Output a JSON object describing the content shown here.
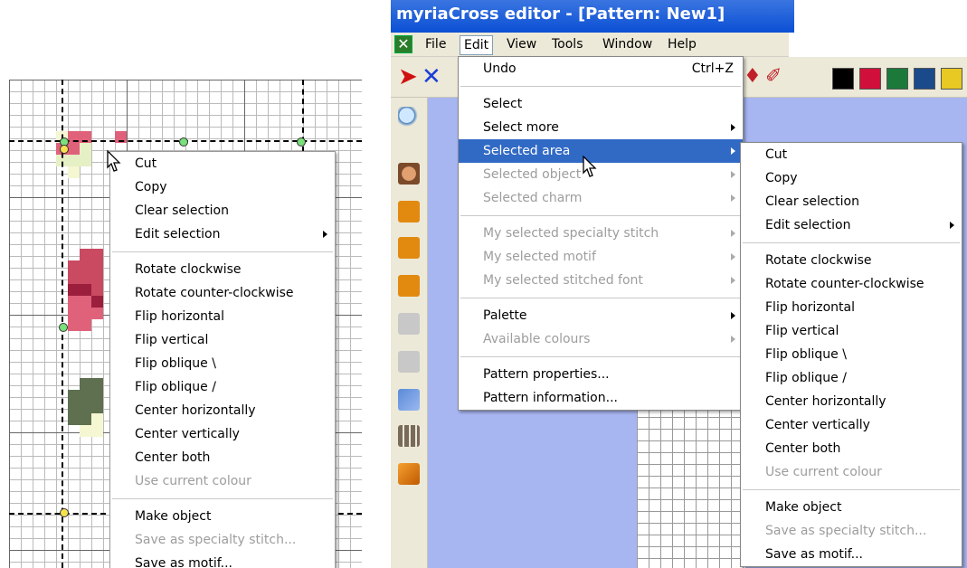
{
  "left_panel": {
    "context_menu": {
      "items": [
        {
          "label": "Cut",
          "enabled": true
        },
        {
          "label": "Copy",
          "enabled": true
        },
        {
          "label": "Clear selection",
          "enabled": true
        },
        {
          "label": "Edit selection",
          "enabled": true,
          "submenu": true
        },
        {
          "separator": true
        },
        {
          "label": "Rotate clockwise",
          "enabled": true
        },
        {
          "label": "Rotate counter-clockwise",
          "enabled": true
        },
        {
          "label": "Flip horizontal",
          "enabled": true
        },
        {
          "label": "Flip vertical",
          "enabled": true
        },
        {
          "label": "Flip oblique \\",
          "enabled": true
        },
        {
          "label": "Flip oblique /",
          "enabled": true
        },
        {
          "label": "Center horizontally",
          "enabled": true
        },
        {
          "label": "Center vertically",
          "enabled": true
        },
        {
          "label": "Center both",
          "enabled": true
        },
        {
          "label": "Use current colour",
          "enabled": false
        },
        {
          "separator": true
        },
        {
          "label": "Make object",
          "enabled": true
        },
        {
          "label": "Save as specialty stitch...",
          "enabled": false
        },
        {
          "label": "Save as motif...",
          "enabled": true
        }
      ]
    },
    "colors": {
      "pink": "#e0627a",
      "darkpink": "#c94a61",
      "maroon": "#9b1f3c",
      "green": "#5e7050",
      "lightgreen": "#e5f0c5",
      "paleyellow": "#f5f7d2"
    }
  },
  "right_panel": {
    "window_title": "myriaCross editor - [Pattern: New1]",
    "menubar": {
      "items": [
        "File",
        "Edit",
        "View",
        "Tools",
        "Window",
        "Help"
      ],
      "active": "Edit"
    },
    "toolbar_colors": [
      "#000000",
      "#d0103a",
      "#1b7a3a",
      "#1b4a8a",
      "#e8c822"
    ],
    "edit_menu": {
      "items": [
        {
          "label": "Undo",
          "shortcut": "Ctrl+Z",
          "enabled": true
        },
        {
          "separator": true
        },
        {
          "label": "Select",
          "enabled": true
        },
        {
          "label": "Select more",
          "enabled": true,
          "submenu": true
        },
        {
          "label": "Selected area",
          "enabled": true,
          "submenu": true,
          "highlighted": true
        },
        {
          "label": "Selected object",
          "enabled": false,
          "submenu": true
        },
        {
          "label": "Selected charm",
          "enabled": false,
          "submenu": true
        },
        {
          "separator": true
        },
        {
          "label": "My selected specialty stitch",
          "enabled": false,
          "submenu": true
        },
        {
          "label": "My selected motif",
          "enabled": false,
          "submenu": true
        },
        {
          "label": "My selected stitched font",
          "enabled": false,
          "submenu": true
        },
        {
          "separator": true
        },
        {
          "label": "Palette",
          "enabled": true,
          "submenu": true
        },
        {
          "label": "Available colours",
          "enabled": false,
          "submenu": true
        },
        {
          "separator": true
        },
        {
          "label": "Pattern properties...",
          "enabled": true
        },
        {
          "label": "Pattern information...",
          "enabled": true
        }
      ]
    },
    "selected_area_submenu": {
      "items": [
        {
          "label": "Cut",
          "enabled": true
        },
        {
          "label": "Copy",
          "enabled": true
        },
        {
          "label": "Clear selection",
          "enabled": true
        },
        {
          "label": "Edit selection",
          "enabled": true,
          "submenu": true
        },
        {
          "separator": true
        },
        {
          "label": "Rotate clockwise",
          "enabled": true
        },
        {
          "label": "Rotate counter-clockwise",
          "enabled": true
        },
        {
          "label": "Flip horizontal",
          "enabled": true
        },
        {
          "label": "Flip vertical",
          "enabled": true
        },
        {
          "label": "Flip oblique \\",
          "enabled": true
        },
        {
          "label": "Flip oblique /",
          "enabled": true
        },
        {
          "label": "Center horizontally",
          "enabled": true
        },
        {
          "label": "Center vertically",
          "enabled": true
        },
        {
          "label": "Center both",
          "enabled": true
        },
        {
          "label": "Use current colour",
          "enabled": false
        },
        {
          "separator": true
        },
        {
          "label": "Make object",
          "enabled": true
        },
        {
          "label": "Save as specialty stitch...",
          "enabled": false
        },
        {
          "label": "Save as motif...",
          "enabled": true
        }
      ]
    }
  }
}
